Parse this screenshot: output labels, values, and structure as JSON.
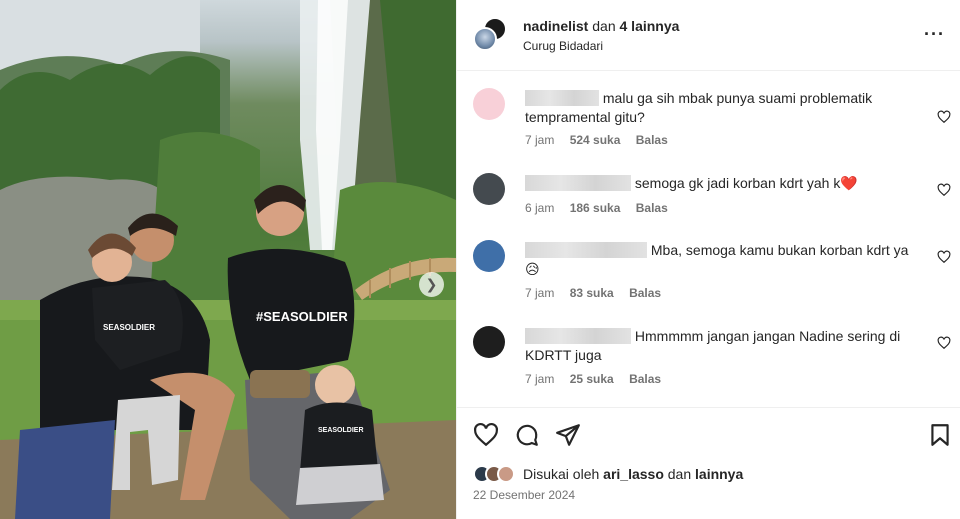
{
  "header": {
    "username": "nadinelist",
    "joiner": "dan",
    "others": "4 lainnya",
    "location": "Curug Bidadari"
  },
  "photo": {
    "shirt_text": "#SEASOLDIER",
    "shirt_small": "SEASOLDIER"
  },
  "comments": [
    {
      "text": "malu ga sih mbak punya suami problematik tempramental gitu?",
      "time": "7 jam",
      "likes": "524 suka",
      "reply": "Balas",
      "avatar_color": "#f8d0d8"
    },
    {
      "text": "semoga gk jadi korban kdrt yah k",
      "emoji": "❤️",
      "time": "6 jam",
      "likes": "186 suka",
      "reply": "Balas",
      "avatar_color": "#444a4f"
    },
    {
      "text": "Mba, semoga kamu bukan korban kdrt ya",
      "emoji": "😥",
      "time": "7 jam",
      "likes": "83 suka",
      "reply": "Balas",
      "avatar_color": "#3f6fa8"
    },
    {
      "text": "Hmmmmm jangan jangan Nadine sering di KDRTT juga",
      "time": "7 jam",
      "likes": "25 suka",
      "reply": "Balas",
      "avatar_color": "#1e1e1e"
    }
  ],
  "footer": {
    "liked_prefix": "Disukai oleh",
    "liked_user": "ari_lasso",
    "liked_joiner": "dan",
    "liked_others": "lainnya",
    "date": "22 Desember 2024"
  },
  "icons": [
    "more-icon",
    "heart-icon",
    "comment-icon",
    "share-icon",
    "bookmark-icon",
    "chevron-right-icon"
  ]
}
